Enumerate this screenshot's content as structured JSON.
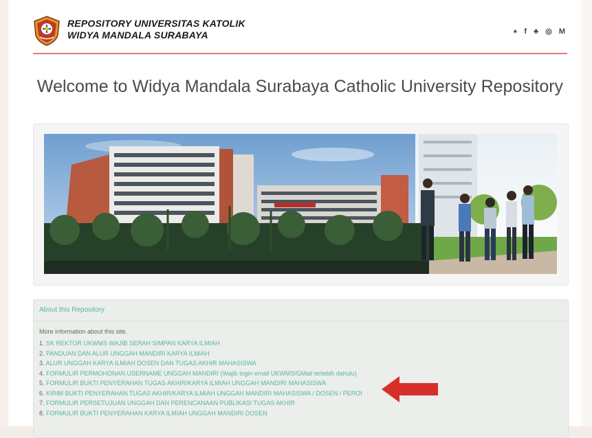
{
  "header": {
    "brand_line1": "REPOSITORY UNIVERSITAS KATOLIK",
    "brand_line2": "WIDYA MANDALA SURABAYA",
    "social_icons": [
      "twitter-icon",
      "facebook-icon",
      "snapchat-icon",
      "instagram-icon",
      "medium-icon"
    ],
    "social_glyphs": [
      "⭑",
      "f",
      "♣",
      "◎",
      "M"
    ]
  },
  "welcome": {
    "title": "Welcome to Widya Mandala Surabaya Catholic University Repository"
  },
  "about": {
    "title": "About this Repository",
    "intro": "More information about this site.",
    "items": [
      {
        "num": "1.",
        "label": "SK REKTOR UKWMS WAJIB SERAH SIMPAN KARYA ILMIAH"
      },
      {
        "num": "2.",
        "label": "PANDUAN DAN ALUR UNGGAH MANDIRI KARYA ILMIAH"
      },
      {
        "num": "3.",
        "label": "ALUR UNGGAH KARYA ILMIAH DOSEN DAN TUGAS AKHIR MAHASISWA"
      },
      {
        "num": "4.",
        "label": "FORMULIR PERMOHONAN USERNAME UNGGAH MANDIRI (Wajib login email UKWMS/GMail terlebih dahulu)"
      },
      {
        "num": "5.",
        "label": "FORMULIR BUKTI PENYERAHAN TUGAS AKHIR/KARYA ILMIAH UNGGAH MANDIRI MAHASISWA"
      },
      {
        "num": "6.",
        "label": "KIRIM BUKTI PENYERAHAN TUGAS AKHIR/KARYA ILMIAH UNGGAH MANDIRI MAHASISWA / DOSEN / PEROI"
      },
      {
        "num": "7.",
        "label": "FORMULIR PERSETUJUAN UNGGAH DAN PERENCANAAN PUBLIKASI TUGAS AKHIR"
      },
      {
        "num": "8.",
        "label": "FORMULIR BUKTI PENYERAHAN KARYA ILMIAH UNGGAH MANDIRI DOSEN"
      }
    ]
  },
  "colors": {
    "accent_link": "#58b3a8",
    "divider": "#e57a74",
    "arrow": "#d62f2a"
  }
}
